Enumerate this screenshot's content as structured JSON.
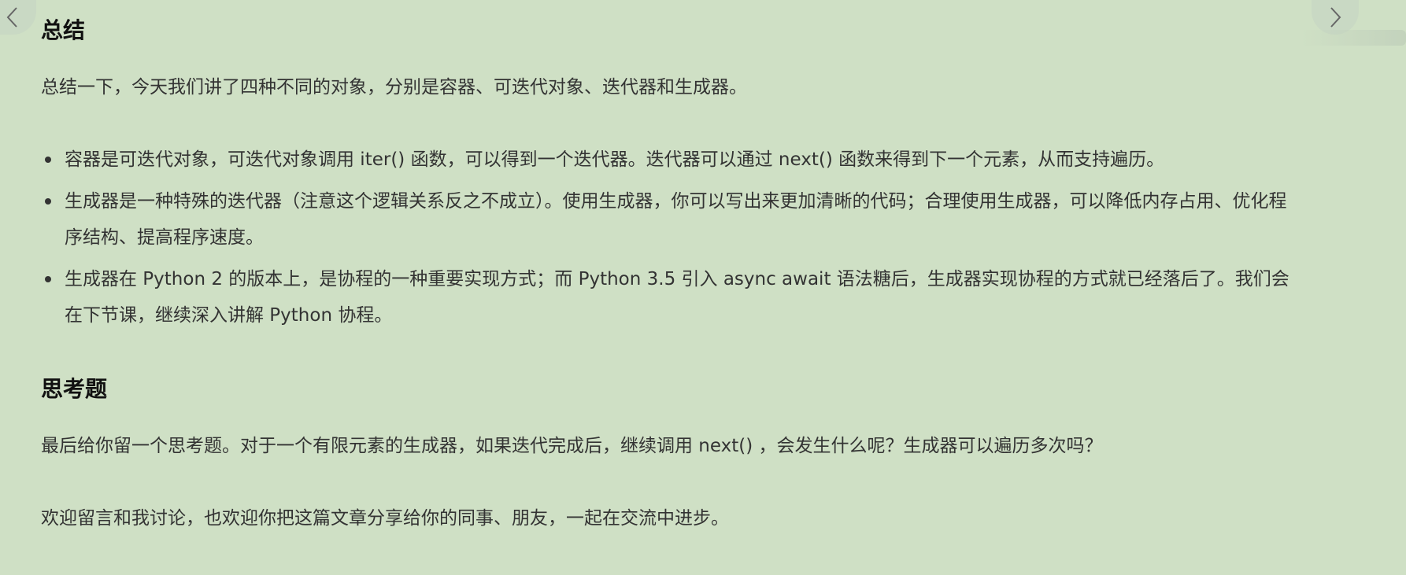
{
  "colors": {
    "background": "#cfe0c5",
    "text": "#333333",
    "heading": "#111111"
  },
  "nav": {
    "prev_icon": "chevron-left-icon",
    "next_icon": "chevron-right-icon"
  },
  "summary": {
    "title": "总结",
    "intro": "总结一下，今天我们讲了四种不同的对象，分别是容器、可迭代对象、迭代器和生成器。",
    "bullets": [
      "容器是可迭代对象，可迭代对象调用 iter() 函数，可以得到一个迭代器。迭代器可以通过 next() 函数来得到下一个元素，从而支持遍历。",
      "生成器是一种特殊的迭代器（注意这个逻辑关系反之不成立）。使用生成器，你可以写出来更加清晰的代码；合理使用生成器，可以降低内存占用、优化程序结构、提高程序速度。",
      "生成器在 Python 2 的版本上，是协程的一种重要实现方式；而 Python 3.5 引入 async await 语法糖后，生成器实现协程的方式就已经落后了。我们会在下节课，继续深入讲解 Python 协程。"
    ]
  },
  "question": {
    "title": "思考题",
    "text": "最后给你留一个思考题。对于一个有限元素的生成器，如果迭代完成后，继续调用 next() ，会发生什么呢？生成器可以遍历多次吗？",
    "invite": "欢迎留言和我讨论，也欢迎你把这篇文章分享给你的同事、朋友，一起在交流中进步。"
  }
}
